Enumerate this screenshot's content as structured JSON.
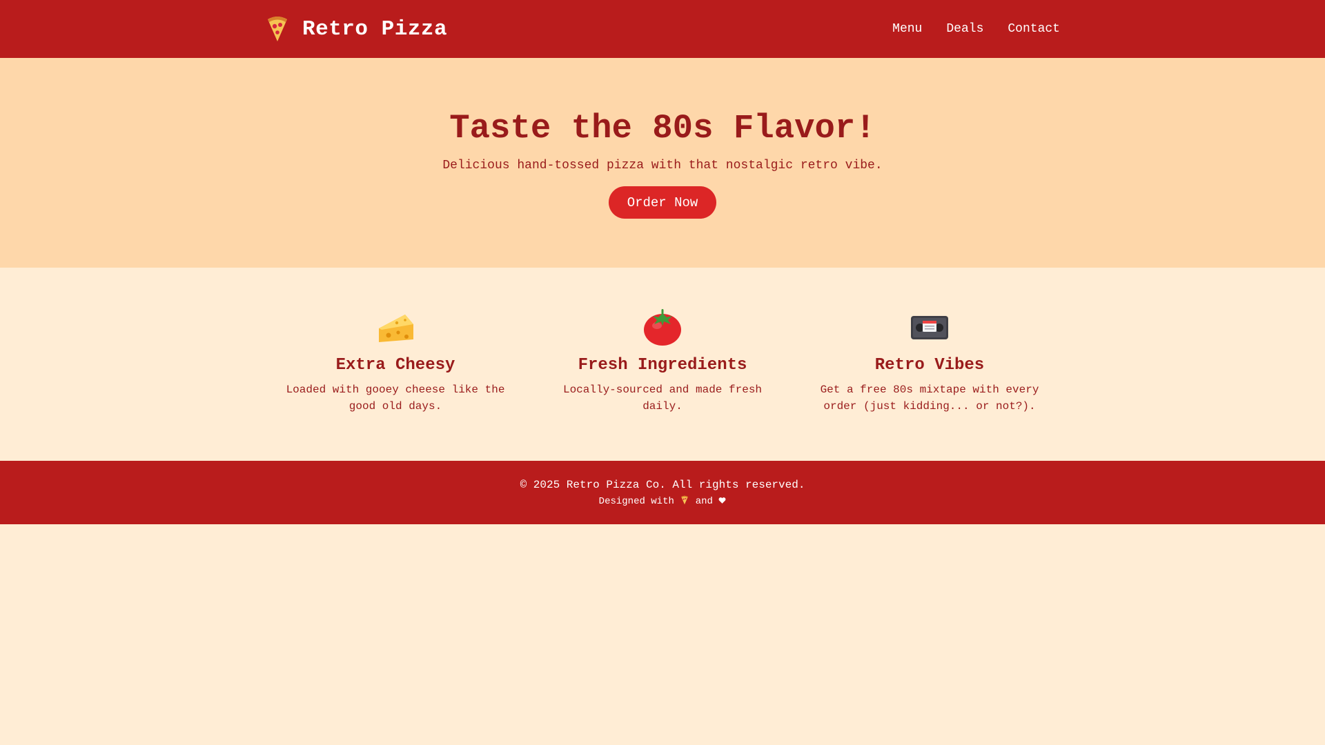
{
  "header": {
    "brand": "Retro Pizza",
    "nav": [
      {
        "label": "Menu"
      },
      {
        "label": "Deals"
      },
      {
        "label": "Contact"
      }
    ]
  },
  "hero": {
    "title": "Taste the 80s Flavor!",
    "subtitle": "Delicious hand-tossed pizza with that nostalgic retro vibe.",
    "cta_label": "Order Now"
  },
  "features": [
    {
      "icon": "cheese-icon",
      "title": "Extra Cheesy",
      "description": "Loaded with gooey cheese like the good old days."
    },
    {
      "icon": "tomato-icon",
      "title": "Fresh Ingredients",
      "description": "Locally-sourced and made fresh daily."
    },
    {
      "icon": "videocassette-icon",
      "title": "Retro Vibes",
      "description": "Get a free 80s mixtape with every order (just kidding... or not?)."
    }
  ],
  "footer": {
    "copyright": "© 2025 Retro Pizza Co. All rights reserved.",
    "credit_prefix": "Designed with",
    "credit_middle": "and"
  },
  "colors": {
    "header_bg": "#B91C1C",
    "hero_bg": "#FED7AA",
    "page_bg": "#FFEDD5",
    "accent_text": "#991B1B",
    "button_bg": "#DC2626"
  }
}
